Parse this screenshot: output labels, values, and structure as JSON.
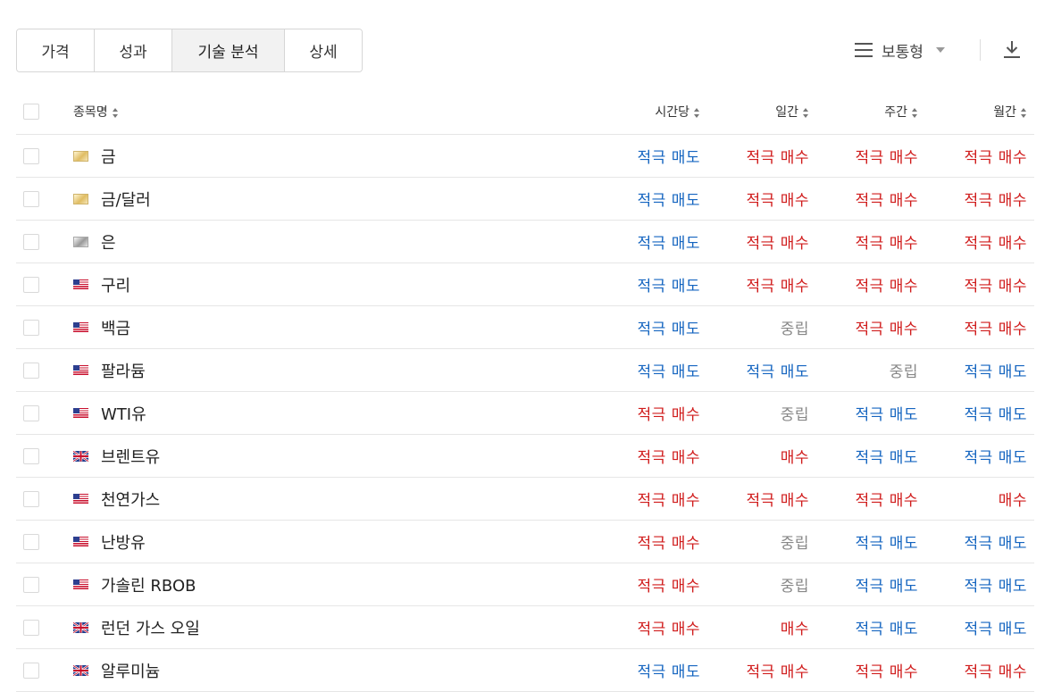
{
  "tabs": [
    {
      "label": "가격",
      "active": false
    },
    {
      "label": "성과",
      "active": false
    },
    {
      "label": "기술 분석",
      "active": true
    },
    {
      "label": "상세",
      "active": false
    }
  ],
  "view": {
    "label": "보통형",
    "icon": "list-icon"
  },
  "download_icon": "download-icon",
  "header": {
    "name": "종목명",
    "hourly": "시간당",
    "daily": "일간",
    "weekly": "주간",
    "monthly": "월간"
  },
  "colors": {
    "sell": "#1565c0",
    "buy": "#d01c1c",
    "neutral": "#888888"
  },
  "rows": [
    {
      "name": "금",
      "flag": "gold",
      "hourly": "적극 매도",
      "daily": "적극 매수",
      "weekly": "적극 매수",
      "monthly": "적극 매수"
    },
    {
      "name": "금/달러",
      "flag": "gold",
      "hourly": "적극 매도",
      "daily": "적극 매수",
      "weekly": "적극 매수",
      "monthly": "적극 매수"
    },
    {
      "name": "은",
      "flag": "silver",
      "hourly": "적극 매도",
      "daily": "적극 매수",
      "weekly": "적극 매수",
      "monthly": "적극 매수"
    },
    {
      "name": "구리",
      "flag": "us",
      "hourly": "적극 매도",
      "daily": "적극 매수",
      "weekly": "적극 매수",
      "monthly": "적극 매수"
    },
    {
      "name": "백금",
      "flag": "us",
      "hourly": "적극 매도",
      "daily": "중립",
      "weekly": "적극 매수",
      "monthly": "적극 매수"
    },
    {
      "name": "팔라듐",
      "flag": "us",
      "hourly": "적극 매도",
      "daily": "적극 매도",
      "weekly": "중립",
      "monthly": "적극 매도"
    },
    {
      "name": "WTI유",
      "flag": "us",
      "hourly": "적극 매수",
      "daily": "중립",
      "weekly": "적극 매도",
      "monthly": "적극 매도"
    },
    {
      "name": "브렌트유",
      "flag": "gb",
      "hourly": "적극 매수",
      "daily": "매수",
      "weekly": "적극 매도",
      "monthly": "적극 매도"
    },
    {
      "name": "천연가스",
      "flag": "us",
      "hourly": "적극 매수",
      "daily": "적극 매수",
      "weekly": "적극 매수",
      "monthly": "매수"
    },
    {
      "name": "난방유",
      "flag": "us",
      "hourly": "적극 매수",
      "daily": "중립",
      "weekly": "적극 매도",
      "monthly": "적극 매도"
    },
    {
      "name": "가솔린 RBOB",
      "flag": "us",
      "hourly": "적극 매수",
      "daily": "중립",
      "weekly": "적극 매도",
      "monthly": "적극 매도"
    },
    {
      "name": "런던 가스 오일",
      "flag": "gb",
      "hourly": "적극 매수",
      "daily": "매수",
      "weekly": "적극 매도",
      "monthly": "적극 매도"
    },
    {
      "name": "알루미늄",
      "flag": "gb",
      "hourly": "적극 매도",
      "daily": "적극 매수",
      "weekly": "적극 매수",
      "monthly": "적극 매수"
    }
  ]
}
